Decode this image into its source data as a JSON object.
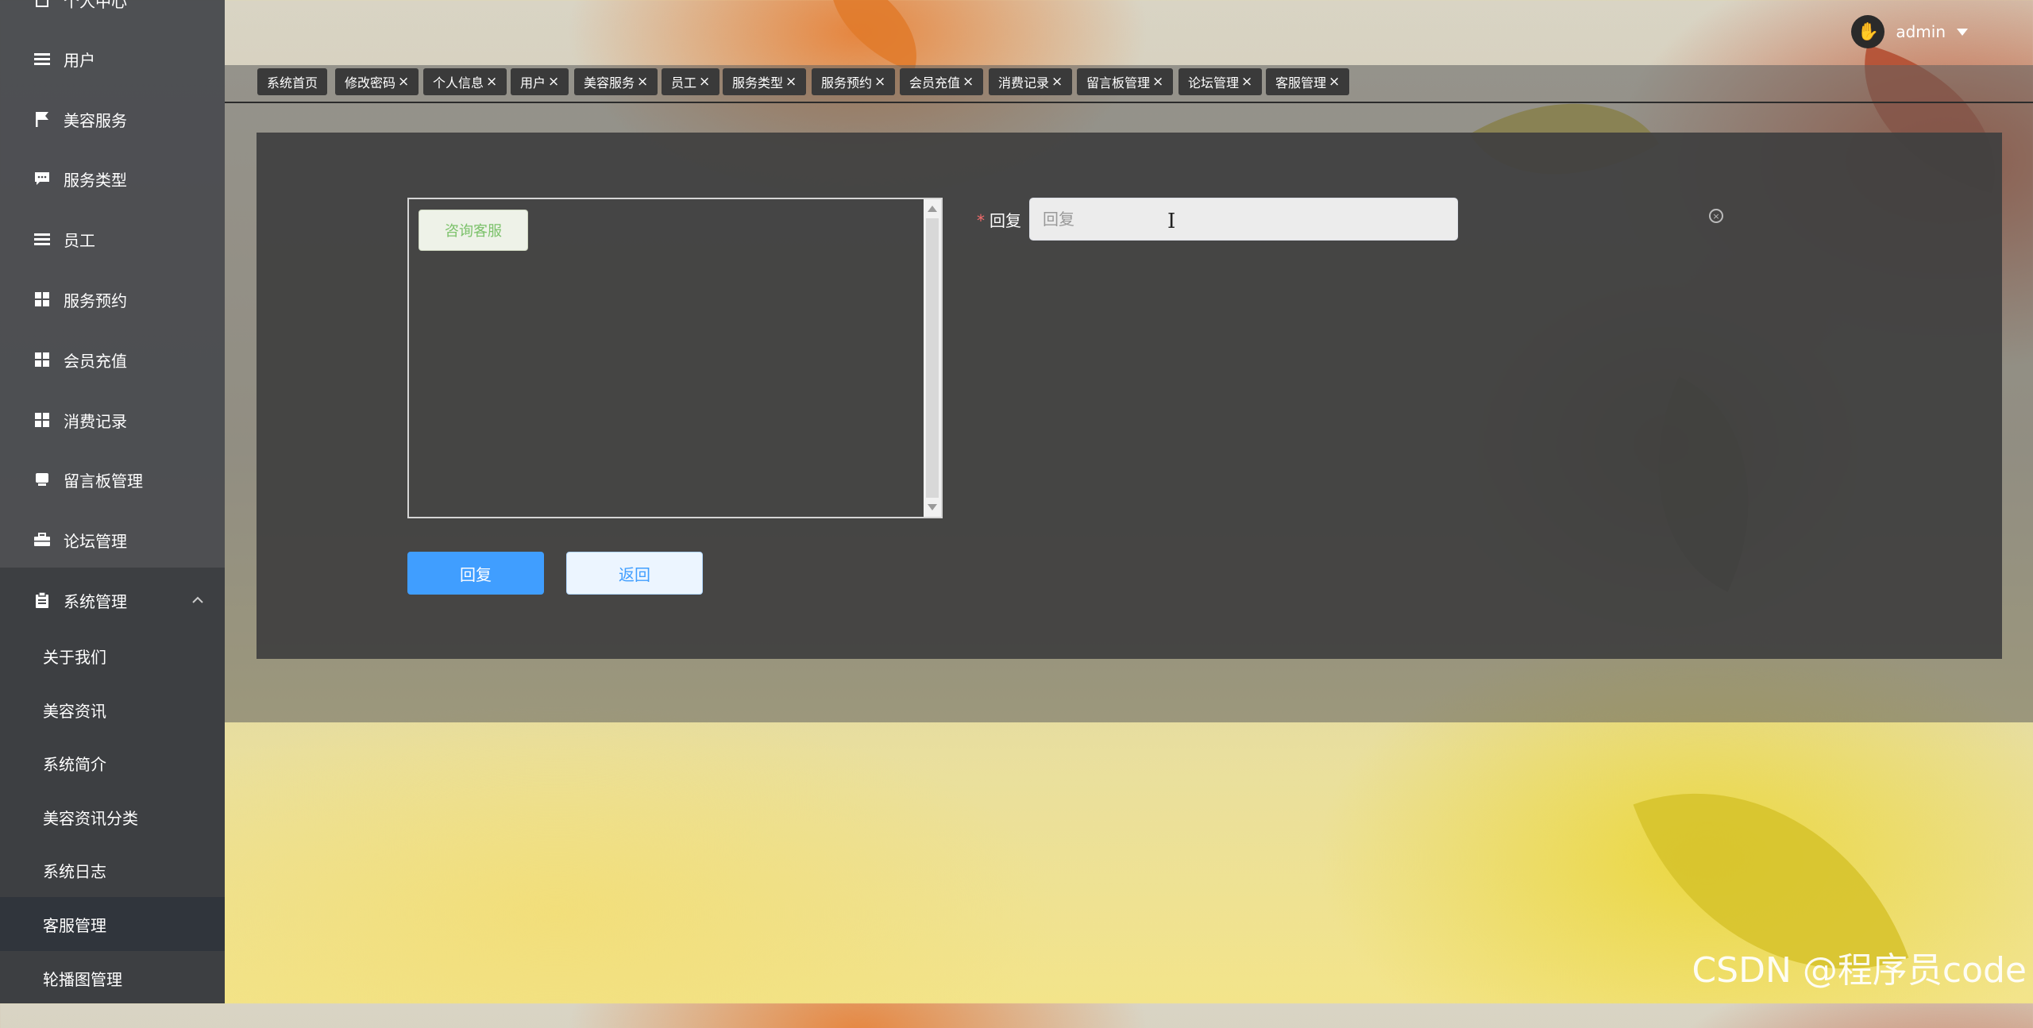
{
  "sidebar": {
    "items": [
      {
        "label": "个人中心",
        "icon": "document-icon"
      },
      {
        "label": "用户",
        "icon": "list-icon"
      },
      {
        "label": "美容服务",
        "icon": "flag-icon"
      },
      {
        "label": "服务类型",
        "icon": "chat-icon"
      },
      {
        "label": "员工",
        "icon": "list-icon"
      },
      {
        "label": "服务预约",
        "icon": "grid-icon"
      },
      {
        "label": "会员充值",
        "icon": "grid-icon"
      },
      {
        "label": "消费记录",
        "icon": "grid-icon"
      },
      {
        "label": "留言板管理",
        "icon": "message-icon"
      },
      {
        "label": "论坛管理",
        "icon": "briefcase-icon"
      },
      {
        "label": "系统管理",
        "icon": "clipboard-icon"
      }
    ],
    "sub_items": [
      {
        "label": "关于我们"
      },
      {
        "label": "美容资讯"
      },
      {
        "label": "系统简介"
      },
      {
        "label": "美容资讯分类"
      },
      {
        "label": "系统日志"
      },
      {
        "label": "客服管理",
        "active": true
      },
      {
        "label": "轮播图管理"
      }
    ]
  },
  "header": {
    "username": "admin",
    "avatar_icon": "hand-icon"
  },
  "tabs": [
    {
      "label": "系统首页",
      "closable": false
    },
    {
      "label": "修改密码",
      "closable": true
    },
    {
      "label": "个人信息",
      "closable": true
    },
    {
      "label": "用户",
      "closable": true
    },
    {
      "label": "美容服务",
      "closable": true
    },
    {
      "label": "员工",
      "closable": true
    },
    {
      "label": "服务类型",
      "closable": true
    },
    {
      "label": "服务预约",
      "closable": true
    },
    {
      "label": "会员充值",
      "closable": true
    },
    {
      "label": "消费记录",
      "closable": true
    },
    {
      "label": "留言板管理",
      "closable": true
    },
    {
      "label": "论坛管理",
      "closable": true
    },
    {
      "label": "客服管理",
      "closable": true
    }
  ],
  "tab_close_glyph": "×",
  "chat": {
    "messages": [
      {
        "text": "咨询客服"
      }
    ]
  },
  "form": {
    "reply_label": "回复",
    "required_mark": "*",
    "reply_placeholder": "回复",
    "reply_value": ""
  },
  "buttons": {
    "submit": "回复",
    "back": "返回"
  },
  "watermark": "CSDN @程序员code",
  "colors": {
    "primary": "#409eff",
    "required": "#f56c6c",
    "chat_text": "#7cc26b",
    "sidebar_bg": "#484a4e",
    "active_item": "#30353c"
  }
}
